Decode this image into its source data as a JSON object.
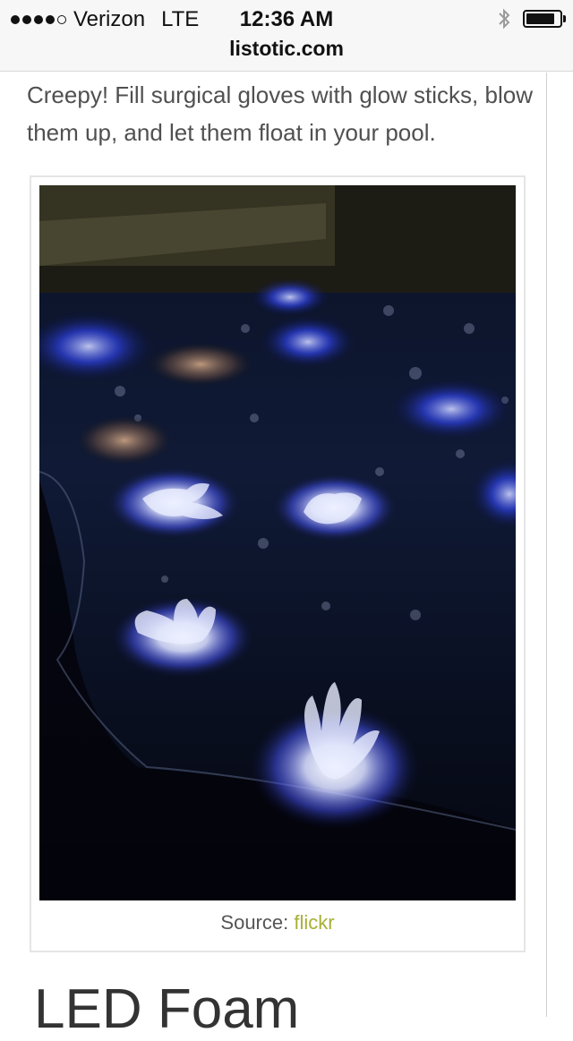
{
  "status_bar": {
    "carrier": "Verizon",
    "network": "LTE",
    "time": "12:36 AM",
    "url": "listotic.com",
    "icons": [
      "signal-dots-icon",
      "bluetooth-icon",
      "battery-icon"
    ],
    "battery_level": 0.85
  },
  "article": {
    "intro_text": "Creepy! Fill surgical gloves with glow sticks, blow them up, and let them float in your pool.",
    "image": {
      "alt": "Glowing gloves floating in a pool"
    },
    "caption": {
      "source_label": "Source:",
      "source_link": "flickr"
    },
    "next_heading": "LED Foam"
  },
  "colors": {
    "link": "#a7b036",
    "body_text": "#505050"
  }
}
